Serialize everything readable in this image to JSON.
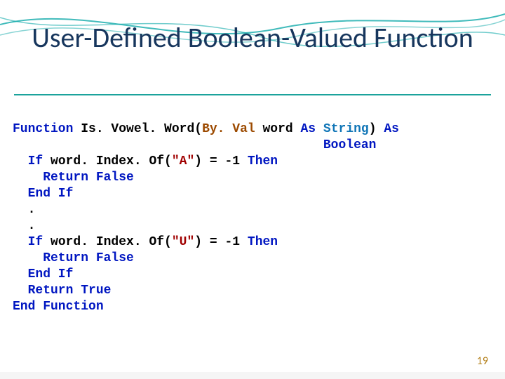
{
  "title": "User-Defined Boolean-Valued Function",
  "code": {
    "l1_kw1": "Function",
    "l1_name": " Is. Vowel. Word(",
    "l1_byval": "By. Val",
    "l1_word": " word ",
    "l1_as1": "As",
    "l1_sp1": " ",
    "l1_type1": "String",
    "l1_close": ") ",
    "l1_as2": "As",
    "l2_pad": "                                         ",
    "l2_type": "Boolean",
    "l3": "  If",
    "l3b": " word. Index. Of(",
    "l3s": "\"A\"",
    "l3c": ") = -1 ",
    "l3t": "Then",
    "l4": "    Return False",
    "l5": "  End If",
    "l6": "  .",
    "l7": "  .",
    "l8": "  If",
    "l8b": " word. Index. Of(",
    "l8s": "\"U\"",
    "l8c": ") = -1 ",
    "l8t": "Then",
    "l9": "    Return False",
    "l10": "  End If",
    "l11": "  Return True",
    "l12": "End Function"
  },
  "page_number": "19"
}
